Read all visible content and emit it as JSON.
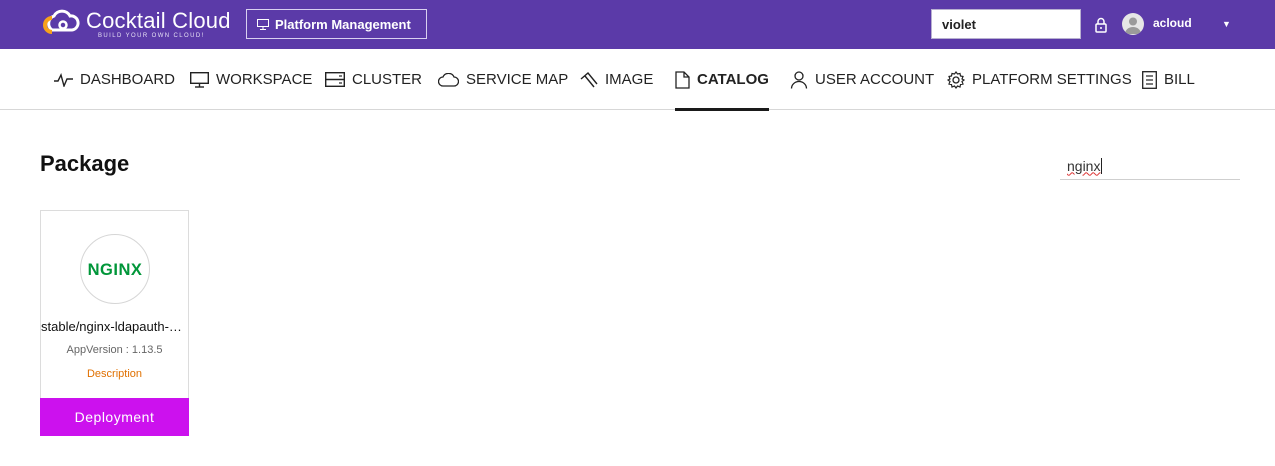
{
  "brand": {
    "name": "Cocktail Cloud",
    "tagline": "BUILD YOUR OWN CLOUD!",
    "logo_icon": "cloud-c-logo-icon",
    "accent": "#5b3aa8"
  },
  "header": {
    "platform_button": "Platform Management",
    "account_value": "violet",
    "user_name": "acloud"
  },
  "nav": {
    "items": [
      {
        "label": "DASHBOARD",
        "icon": "pulse-icon"
      },
      {
        "label": "WORKSPACE",
        "icon": "monitor-icon"
      },
      {
        "label": "CLUSTER",
        "icon": "server-icon"
      },
      {
        "label": "SERVICE MAP",
        "icon": "cloud-icon"
      },
      {
        "label": "IMAGE",
        "icon": "image-icon"
      },
      {
        "label": "CATALOG",
        "icon": "document-icon",
        "active": true
      },
      {
        "label": "USER ACCOUNT",
        "icon": "user-icon"
      },
      {
        "label": "PLATFORM SETTINGS",
        "icon": "gear-icon"
      },
      {
        "label": "BILL",
        "icon": "receipt-icon"
      }
    ]
  },
  "main": {
    "title": "Package",
    "search_value": "nginx",
    "packages": [
      {
        "name": "stable/nginx-ldapauth-proxy",
        "logo_text": "NGINX",
        "logo_color": "#009639",
        "version": "AppVersion : 1.13.5",
        "description_link": "Description",
        "deploy_label": "Deployment",
        "deploy_color": "#cc11ee"
      }
    ]
  }
}
